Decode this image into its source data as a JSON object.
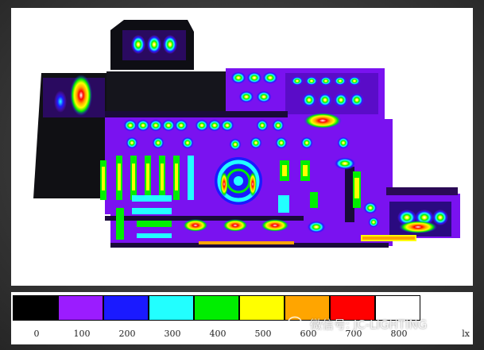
{
  "legend": {
    "unit": "lx",
    "swatches": [
      {
        "label": "0",
        "color": "#000000"
      },
      {
        "label": "100",
        "color": "#9b1cff"
      },
      {
        "label": "200",
        "color": "#1a1aff"
      },
      {
        "label": "300",
        "color": "#22ffff"
      },
      {
        "label": "400",
        "color": "#00ee00"
      },
      {
        "label": "500",
        "color": "#ffff00"
      },
      {
        "label": "600",
        "color": "#ffa500"
      },
      {
        "label": "700",
        "color": "#ff0000"
      },
      {
        "label": "800",
        "color": "#ffffff"
      }
    ]
  },
  "watermark": {
    "text": "微信号: JC-LIGHTING",
    "icon": "wechat-icon"
  },
  "palette": {
    "floor": "#7a12f0",
    "dark": "#12121a",
    "wall": "#2a1a44"
  }
}
